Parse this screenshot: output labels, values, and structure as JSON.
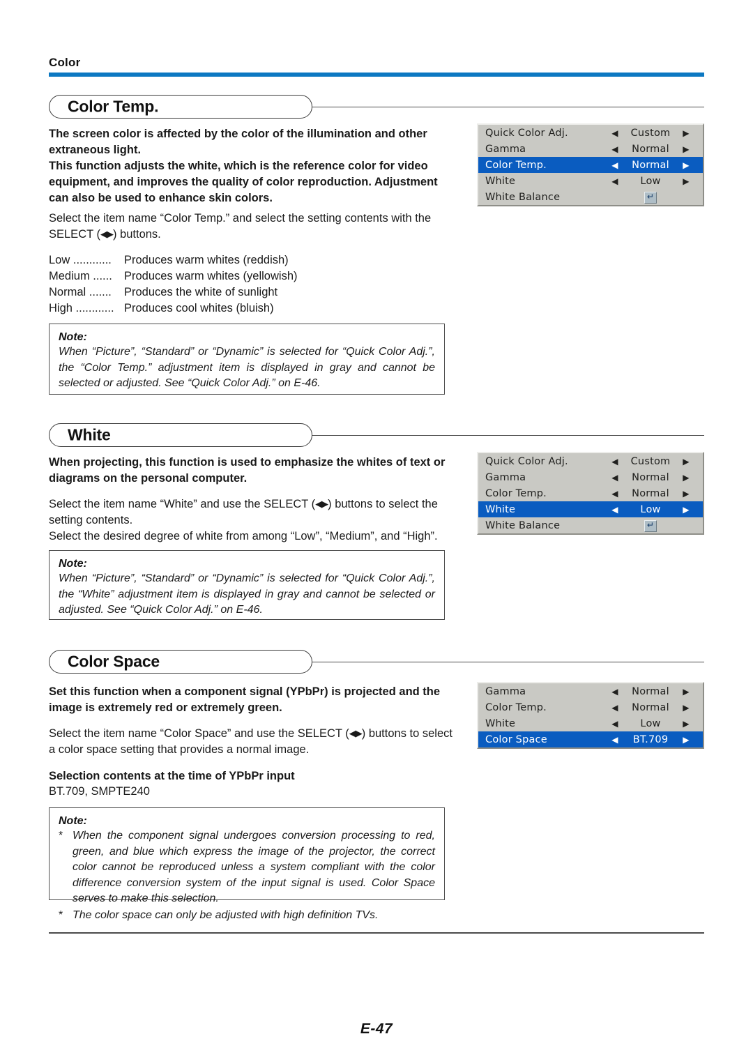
{
  "page": {
    "running_head": "Color",
    "folio": "E-47",
    "accent_color": "#0c78c2",
    "osd_highlight_color": "#0a5cc0",
    "osd_background_color": "#c9c9c4"
  },
  "sections": [
    {
      "id": "color-temp",
      "title": "Color Temp.",
      "intro_bold": "The screen color is affected by the color of the illumination and other extraneous light.\nThis function adjusts the white, which is the reference color for video equipment, and improves the quality of color reproduction. Adjustment can also be used to enhance skin colors.",
      "instruction_pre": "Select the item name “Color Temp.” and select the setting contents with the SELECT (",
      "instruction_arrows": "◀▶",
      "instruction_post": ") buttons.",
      "definitions": [
        {
          "term": "Low",
          "leader": "............",
          "desc": "Produces warm whites (reddish)"
        },
        {
          "term": "Medium",
          "leader": "......",
          "desc": "Produces warm whites (yellowish)"
        },
        {
          "term": "Normal",
          "leader": ".......",
          "desc": "Produces the white of sunlight"
        },
        {
          "term": "High",
          "leader": "............",
          "desc": "Produces cool whites (bluish)"
        }
      ],
      "note": {
        "title": "Note:",
        "body": "When “Picture”, “Standard” or “Dynamic” is selected for “Quick Color Adj.”, the “Color Temp.” adjustment item is displayed in gray and cannot be selected or adjusted. See “Quick Color Adj.” on E-46."
      }
    },
    {
      "id": "white",
      "title": "White",
      "intro_bold": "When projecting, this function is used to emphasize the whites of text or diagrams on the personal computer.",
      "instruction_pre": "Select the item name “White” and use the SELECT (",
      "instruction_arrows": "◀▶",
      "instruction_post": ") buttons to select the setting contents.",
      "instruction_line2": "Select the desired degree of white from among “Low”, “Medium”, and “High”.",
      "note": {
        "title": "Note:",
        "body": "When “Picture”, “Standard” or “Dynamic” is selected for “Quick Color Adj.”, the “White” adjustment item is displayed in gray and cannot be selected or adjusted. See “Quick Color Adj.” on E-46."
      }
    },
    {
      "id": "color-space",
      "title": "Color Space",
      "intro_bold": "Set this function when a component signal (YPbPr) is projected and the image is extremely red or extremely green.",
      "instruction_pre": "Select the item name “Color Space” and use the SELECT (",
      "instruction_arrows": "◀▶",
      "instruction_post": ") buttons to select a color space setting that provides a normal image.",
      "selection_heading": "Selection contents at the time of YPbPr input",
      "selection_values": "BT.709, SMPTE240",
      "note": {
        "title": "Note:",
        "bullets": [
          {
            "marker": "*",
            "text": "When the component signal undergoes conversion processing to red, green, and blue which express the image of the projector, the correct color cannot be reproduced unless a system compliant with the color difference conversion system of the input signal is used. Color Space serves to make this selection."
          },
          {
            "marker": "*",
            "text": "The color space can only be adjusted with high definition TVs."
          }
        ]
      }
    }
  ],
  "osd_menus": [
    {
      "id": "osd-color-temp",
      "rows": [
        {
          "name": "Quick Color Adj.",
          "left": "◀",
          "value": "Custom",
          "right": "▶",
          "selected": false,
          "type": "value"
        },
        {
          "name": "Gamma",
          "left": "◀",
          "value": "Normal",
          "right": "▶",
          "selected": false,
          "type": "value"
        },
        {
          "name": "Color Temp.",
          "left": "◀",
          "value": "Normal",
          "right": "▶",
          "selected": true,
          "type": "value"
        },
        {
          "name": "White",
          "left": "◀",
          "value": "Low",
          "right": "▶",
          "selected": false,
          "type": "value"
        },
        {
          "name": "White Balance",
          "left": "",
          "value": "↵",
          "right": "",
          "selected": false,
          "type": "enter"
        }
      ]
    },
    {
      "id": "osd-white",
      "rows": [
        {
          "name": "Quick Color Adj.",
          "left": "◀",
          "value": "Custom",
          "right": "▶",
          "selected": false,
          "type": "value"
        },
        {
          "name": "Gamma",
          "left": "◀",
          "value": "Normal",
          "right": "▶",
          "selected": false,
          "type": "value"
        },
        {
          "name": "Color Temp.",
          "left": "◀",
          "value": "Normal",
          "right": "▶",
          "selected": false,
          "type": "value"
        },
        {
          "name": "White",
          "left": "◀",
          "value": "Low",
          "right": "▶",
          "selected": true,
          "type": "value"
        },
        {
          "name": "White Balance",
          "left": "",
          "value": "↵",
          "right": "",
          "selected": false,
          "type": "enter"
        }
      ]
    },
    {
      "id": "osd-color-space",
      "rows": [
        {
          "name": "Gamma",
          "left": "◀",
          "value": "Normal",
          "right": "▶",
          "selected": false,
          "type": "value"
        },
        {
          "name": "Color Temp.",
          "left": "◀",
          "value": "Normal",
          "right": "▶",
          "selected": false,
          "type": "value"
        },
        {
          "name": "White",
          "left": "◀",
          "value": "Low",
          "right": "▶",
          "selected": false,
          "type": "value"
        },
        {
          "name": "Color Space",
          "left": "◀",
          "value": "BT.709",
          "right": "▶",
          "selected": true,
          "type": "value"
        }
      ]
    }
  ]
}
